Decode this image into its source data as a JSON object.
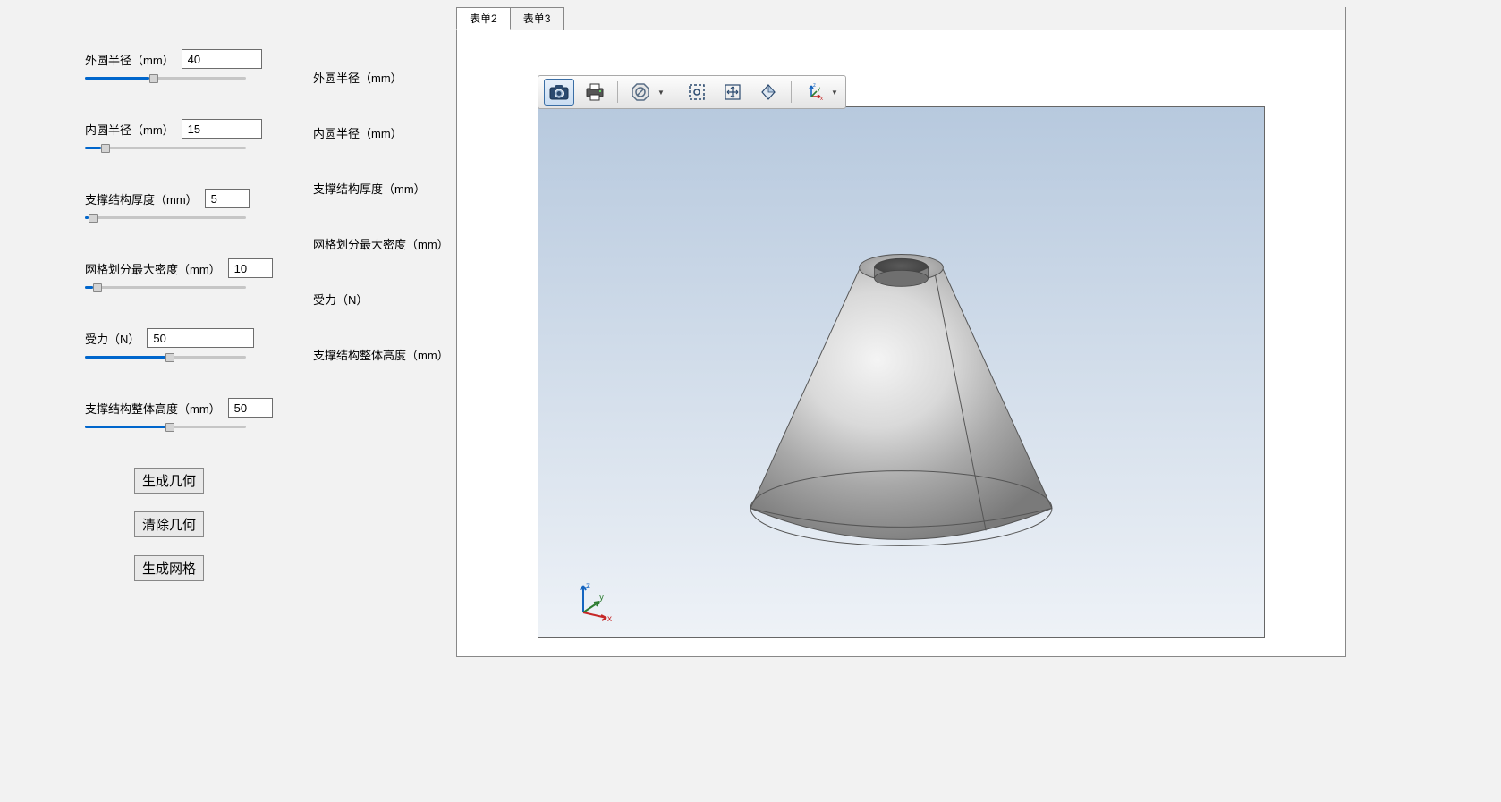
{
  "params": {
    "outer_radius": {
      "label": "外圆半径（mm）",
      "value": "40",
      "slider_pct": 40
    },
    "inner_radius": {
      "label": "内圆半径（mm）",
      "value": "15",
      "slider_pct": 10
    },
    "support_thickness": {
      "label": "支撑结构厚度（mm）",
      "value": "5",
      "slider_pct": 2
    },
    "mesh_density": {
      "label": "网格划分最大密度（mm）",
      "value": "10",
      "slider_pct": 5
    },
    "force": {
      "label": "受力（N）",
      "value": "50",
      "slider_pct": 50
    },
    "support_height": {
      "label": "支撑结构整体高度（mm）",
      "value": "50",
      "slider_pct": 50
    }
  },
  "display_labels": {
    "outer_radius": "外圆半径（mm）",
    "inner_radius": "内圆半径（mm）",
    "support_thickness": "支撑结构厚度（mm）",
    "mesh_density": "网格划分最大密度（mm）",
    "force": "受力（N）",
    "support_height": "支撑结构整体高度（mm）"
  },
  "buttons": {
    "generate_geometry": "生成几何",
    "clear_geometry": "清除几何",
    "generate_mesh": "生成网格"
  },
  "tabs": {
    "tab2": "表单2",
    "tab3": "表单3"
  },
  "toolbar": {
    "camera": "camera-icon",
    "print": "print-icon",
    "disable": "disable-icon",
    "select_box": "select-box-icon",
    "pan": "pan-icon",
    "rotate": "rotate-icon",
    "axes": "axes-icon"
  },
  "axes": {
    "x": "x",
    "y": "y",
    "z": "z"
  }
}
